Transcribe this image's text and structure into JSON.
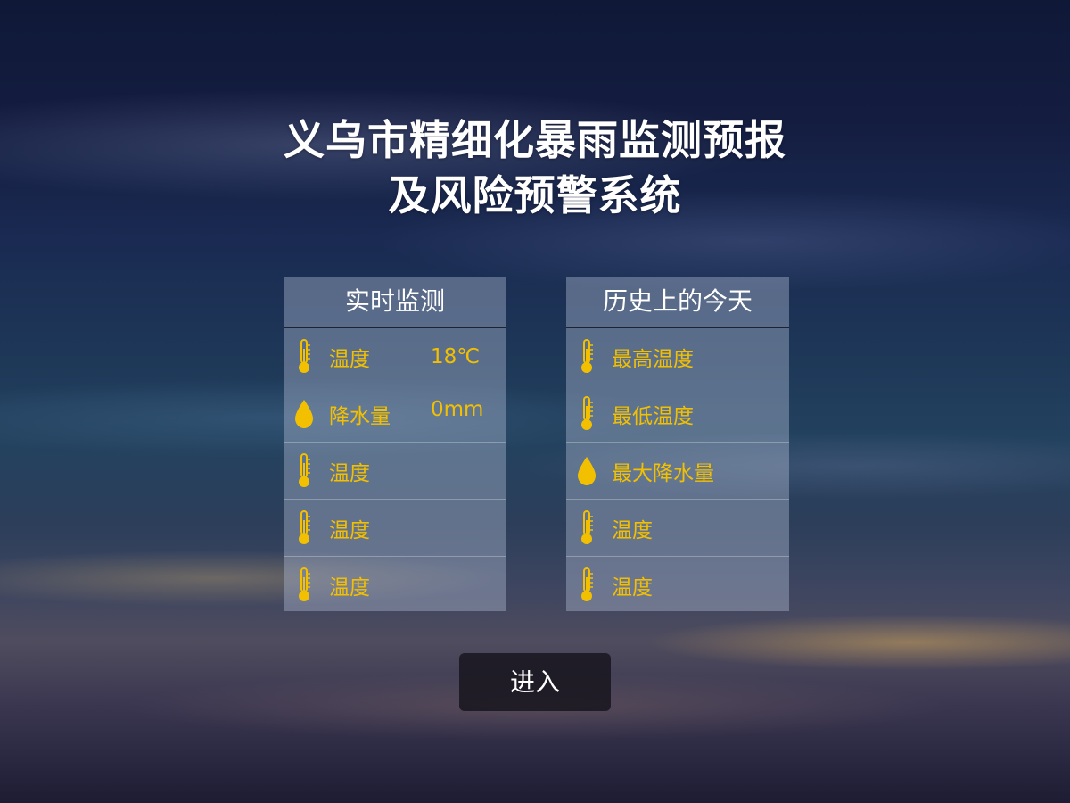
{
  "title": {
    "line1": "义乌市精细化暴雨监测预报",
    "line2": "及风险预警系统"
  },
  "realtime": {
    "header": "实时监测",
    "rows": [
      {
        "icon": "thermometer-icon",
        "label": "温度",
        "value": "18℃"
      },
      {
        "icon": "raindrop-icon",
        "label": "降水量",
        "value": "0mm"
      },
      {
        "icon": "thermometer-icon",
        "label": "温度",
        "value": ""
      },
      {
        "icon": "thermometer-icon",
        "label": "温度",
        "value": ""
      },
      {
        "icon": "thermometer-icon",
        "label": "温度",
        "value": ""
      }
    ]
  },
  "history": {
    "header": "历史上的今天",
    "rows": [
      {
        "icon": "thermometer-icon",
        "label": "最高温度"
      },
      {
        "icon": "thermometer-icon",
        "label": "最低温度"
      },
      {
        "icon": "raindrop-icon",
        "label": "最大降水量"
      },
      {
        "icon": "thermometer-icon",
        "label": "温度"
      },
      {
        "icon": "thermometer-icon",
        "label": "温度"
      }
    ]
  },
  "enter_button": {
    "label": "进入"
  },
  "colors": {
    "accent": "#f2c000",
    "text": "#ffffff",
    "panel": "#afb9d2",
    "button": "#16141c"
  }
}
